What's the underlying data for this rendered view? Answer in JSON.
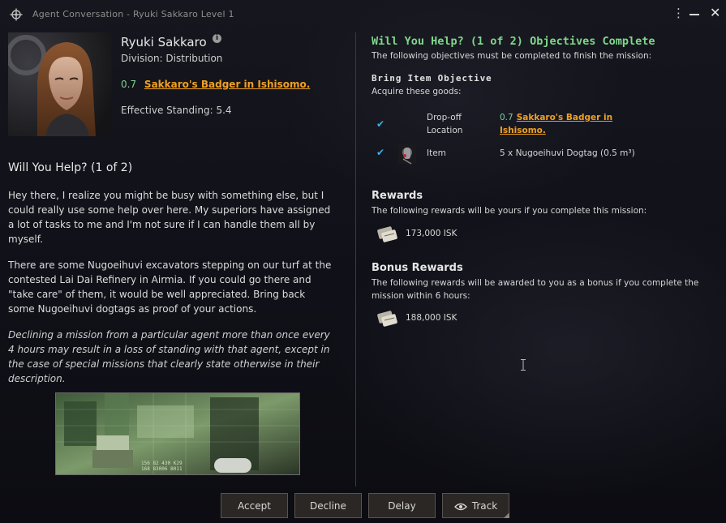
{
  "window": {
    "title": "Agent Conversation - Ryuki Sakkaro Level 1",
    "menu_glyph": "⋮",
    "close_glyph": "✕"
  },
  "agent": {
    "name": "Ryuki Sakkaro",
    "info_glyph": "i",
    "division": "Division: Distribution",
    "security": "0.7",
    "location": "Sakkaro's Badger in Ishisomo.",
    "standing": "Effective Standing: 5.4"
  },
  "mission": {
    "title": "Will You Help? (1 of 2)",
    "paragraphs": [
      "Hey there, I realize you might be busy with something else, but I could really use some help over here. My superiors have assigned a lot of tasks to me and I'm not sure if I can handle them all by myself.",
      "There are some Nugoeihuvi excavators stepping on our turf at the contested Lai Dai Refinery in Airmia. If you could go there and \"take care\" of them, it would be well appreciated. Bring back some Nugoeihuvi dogtags as proof of your actions."
    ],
    "warning": "Declining a mission from a particular agent more than once every 4 hours may result in a loss of standing with that agent, except in the case of special missions that clearly state otherwise in their description.",
    "image_text": [
      "156 82 430 K29",
      "168 83006 B011"
    ]
  },
  "objectives": {
    "title": "Will You Help? (1 of 2) Objectives Complete",
    "subtitle": "The following objectives must be completed to finish the mission:",
    "bring_title": "Bring Item Objective",
    "bring_subtitle": "Acquire these goods:",
    "check_glyph": "✔",
    "rows": [
      {
        "label": "Drop-off Location",
        "security": "0.7",
        "value": "Sakkaro's Badger in Ishisomo."
      },
      {
        "label": "Item",
        "value": "5 x Nugoeihuvi Dogtag (0.5 m³)"
      }
    ]
  },
  "rewards": {
    "title": "Rewards",
    "subtitle": "The following rewards will be yours if you complete this mission:",
    "amount": "173,000 ISK"
  },
  "bonus": {
    "title": "Bonus Rewards",
    "subtitle": "The following rewards will be awarded to you as a bonus if you complete the mission within 6 hours:",
    "amount": "188,000 ISK"
  },
  "buttons": {
    "accept": "Accept",
    "decline": "Decline",
    "delay": "Delay",
    "track": "Track"
  },
  "colors": {
    "link": "#f0a022",
    "security_high": "#7fd08f",
    "objective_title": "#7fd88a",
    "check": "#3fb0e8"
  },
  "icons": {
    "app": "compass-icon",
    "item": "dogtag-icon",
    "isk": "isk-icon",
    "track": "eye-icon"
  }
}
